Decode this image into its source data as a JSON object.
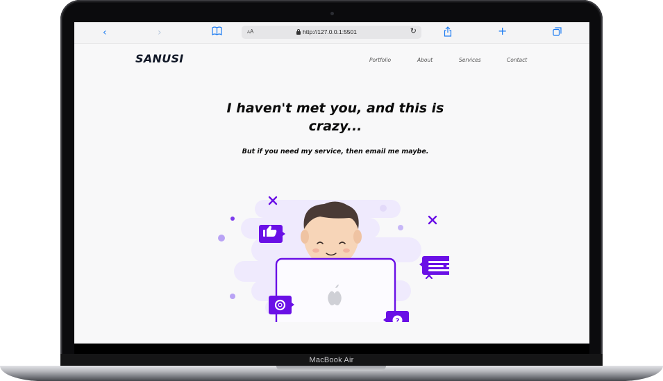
{
  "device": {
    "model_label": "MacBook Air"
  },
  "browser": {
    "text_size_label": "AA",
    "url": "http://127.0.0.1:5501",
    "icons": [
      "back-icon",
      "forward-icon",
      "bookmarks-icon",
      "reload-icon",
      "share-icon",
      "new-tab-icon",
      "tabs-icon"
    ]
  },
  "site": {
    "brand": "SANUSI",
    "nav": [
      "Portfolio",
      "About",
      "Services",
      "Contact"
    ],
    "hero": {
      "title": "I haven't met you, and this is crazy...",
      "subtitle": "But if you need my service, then email me maybe."
    }
  },
  "colors": {
    "accent": "#6a10e6",
    "accent_light": "#efeafd",
    "safari_blue": "#1d7cf2",
    "text": "#0b0b0b"
  }
}
